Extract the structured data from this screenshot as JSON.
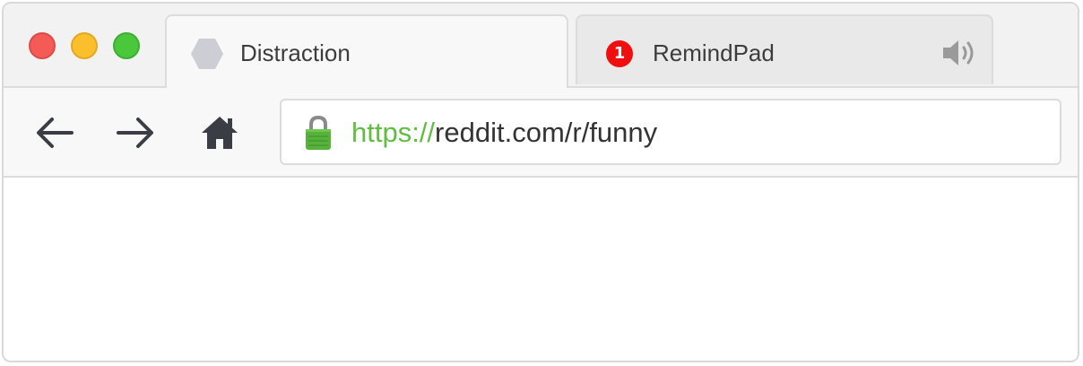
{
  "window": {
    "controls": {
      "close_color": "#f45b57",
      "minimize_color": "#fbbf2c",
      "maximize_color": "#4bc73c"
    }
  },
  "tabs": [
    {
      "title": "Distraction",
      "icon": "hexagon-icon",
      "active": true
    },
    {
      "title": "RemindPad",
      "icon": "notification-badge",
      "badge": "1",
      "audio_icon": "speaker-icon",
      "active": false
    }
  ],
  "toolbar": {
    "back_icon": "arrow-left-icon",
    "forward_icon": "arrow-right-icon",
    "home_icon": "home-icon"
  },
  "address_bar": {
    "lock_icon": "lock-icon",
    "scheme": "https://",
    "rest": "reddit.com/r/funny",
    "scheme_color": "#5fbd3f"
  }
}
